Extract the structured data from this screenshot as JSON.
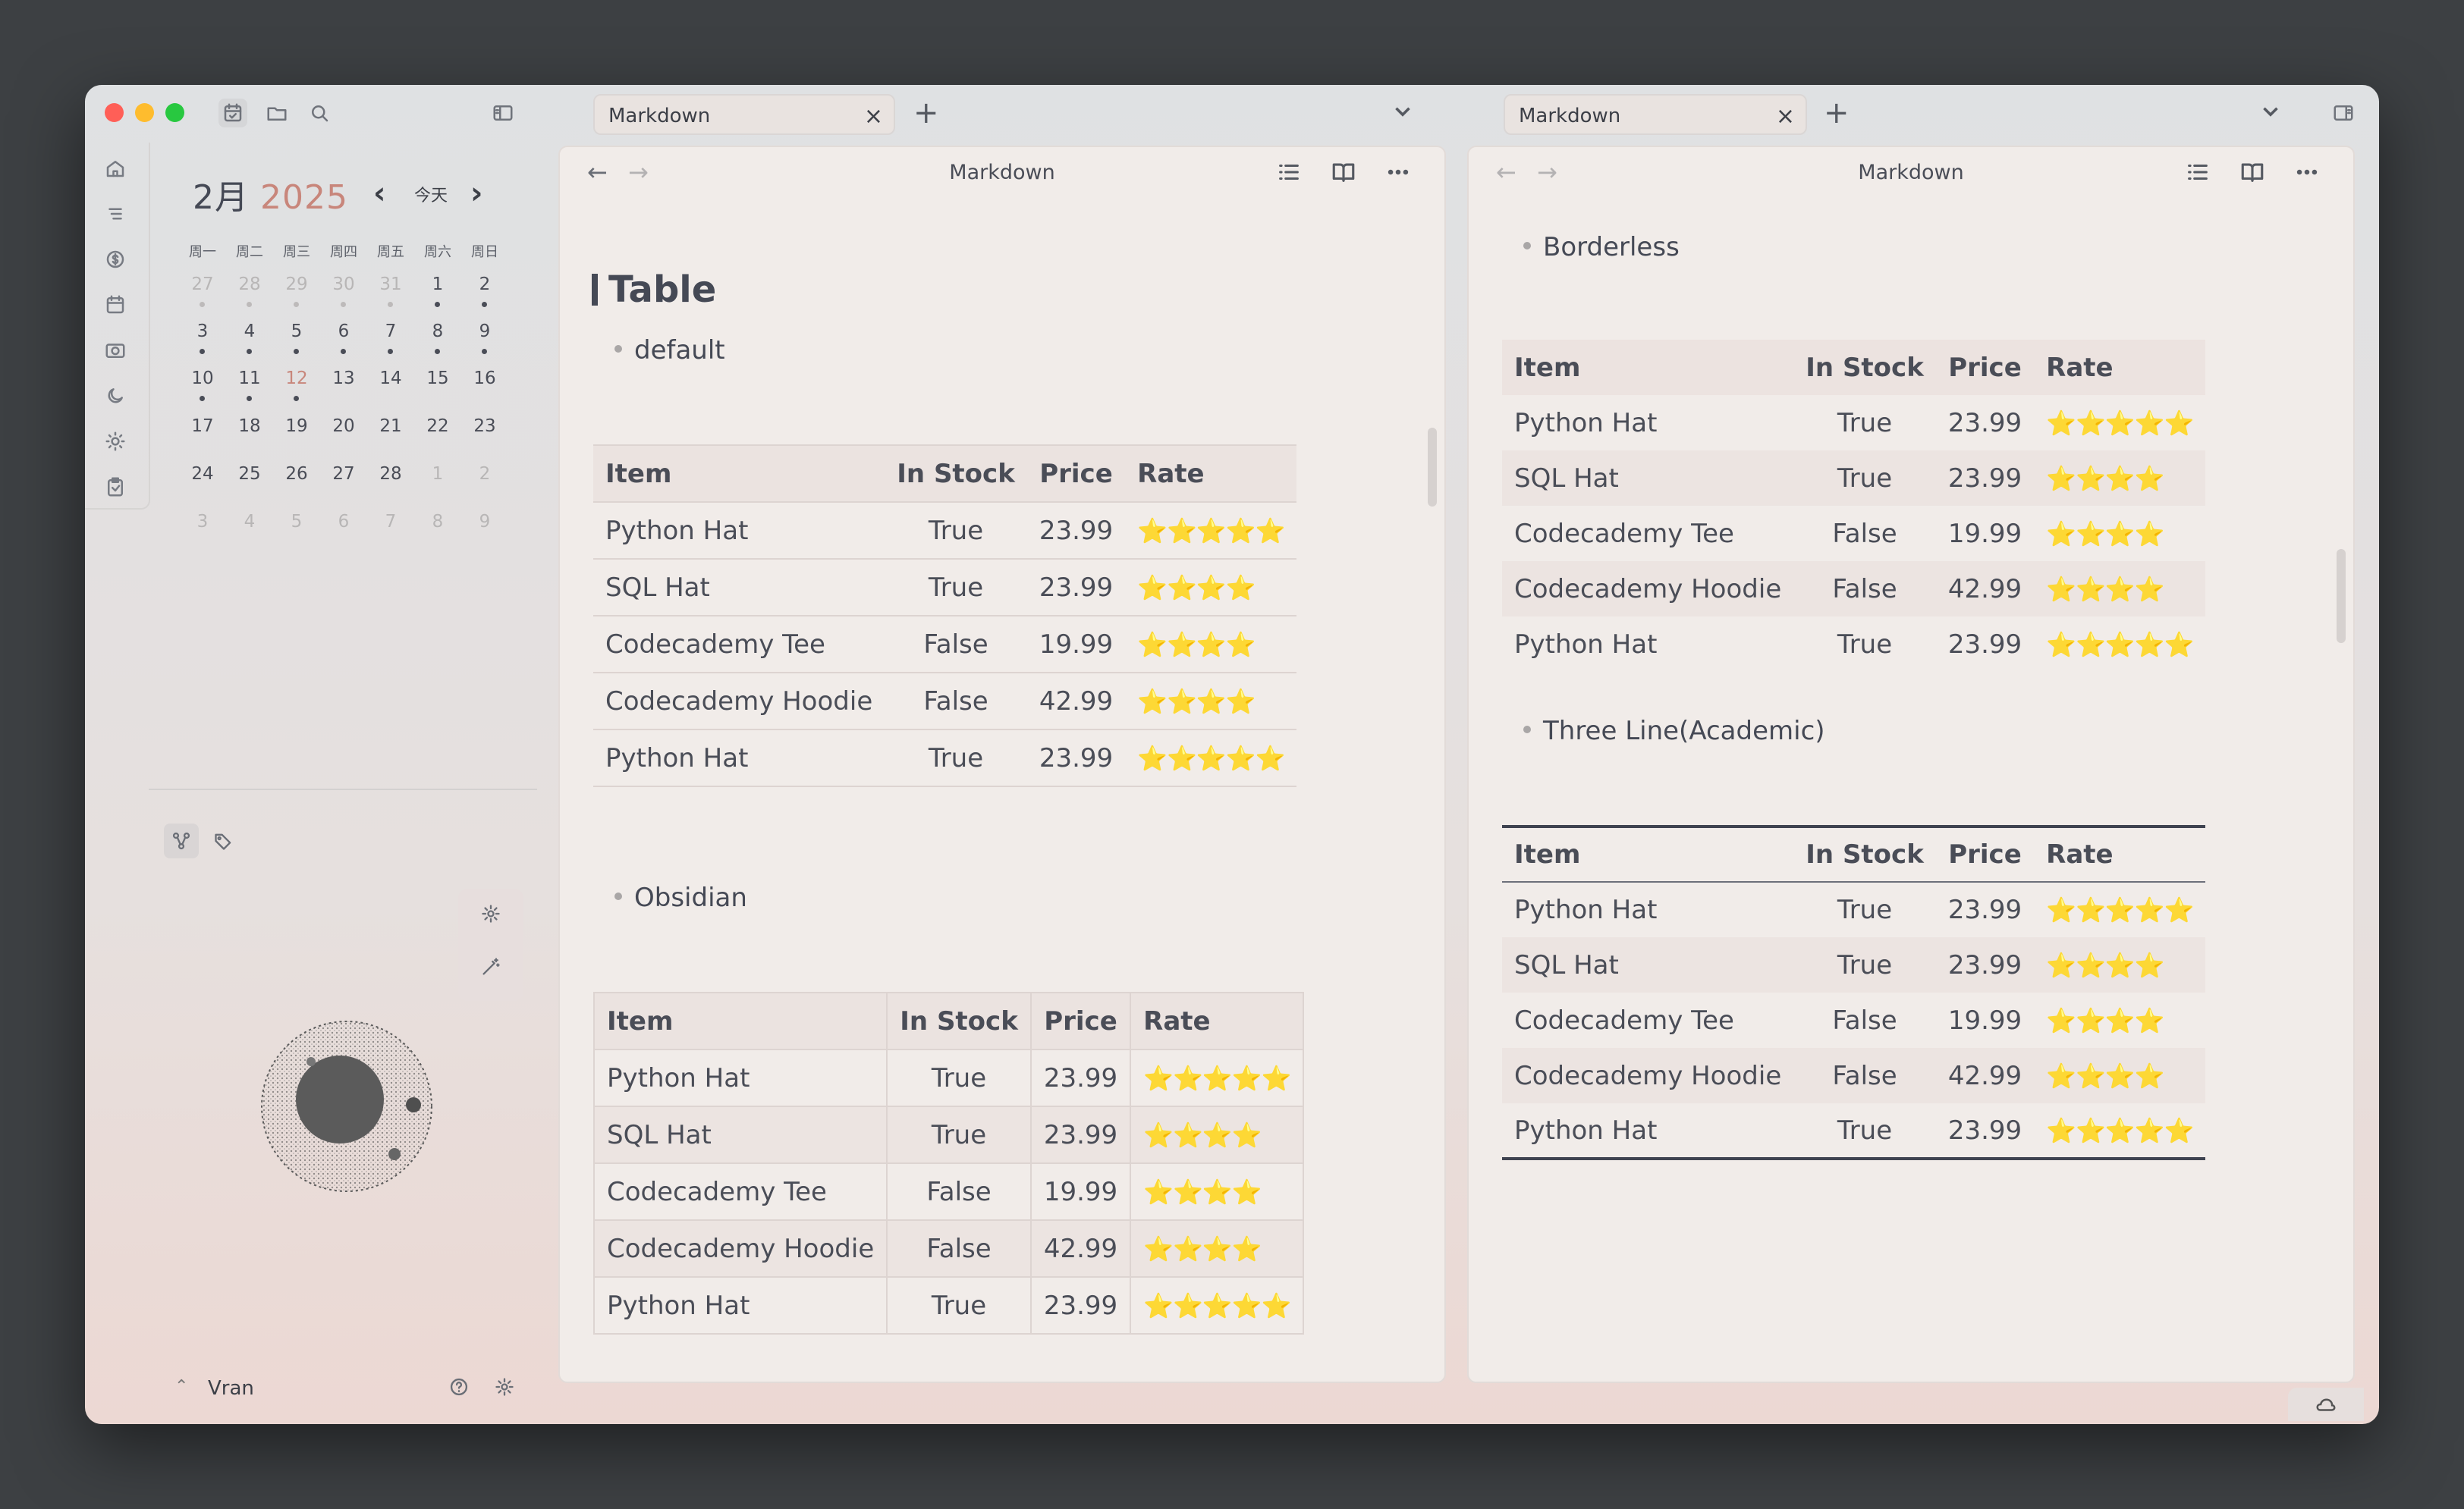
{
  "window": {
    "left_tab": {
      "label": "Markdown"
    },
    "right_tab": {
      "label": "Markdown"
    },
    "new_tab_symbol": "+",
    "close_symbol": "×"
  },
  "calendar": {
    "month": "2月",
    "year": "2025",
    "today_label": "今天",
    "weekdays": [
      "周一",
      "周二",
      "周三",
      "周四",
      "周五",
      "周六",
      "周日"
    ],
    "weeks": [
      [
        "27",
        "28",
        "29",
        "30",
        "31",
        "1",
        "2"
      ],
      [
        "3",
        "4",
        "5",
        "6",
        "7",
        "8",
        "9"
      ],
      [
        "10",
        "11",
        "12",
        "13",
        "14",
        "15",
        "16"
      ],
      [
        "17",
        "18",
        "19",
        "20",
        "21",
        "22",
        "23"
      ],
      [
        "24",
        "25",
        "26",
        "27",
        "28",
        "1",
        "2"
      ],
      [
        "3",
        "4",
        "5",
        "6",
        "7",
        "8",
        "9"
      ]
    ]
  },
  "vault": {
    "name": "Vran"
  },
  "left_pane": {
    "header_title": "Markdown",
    "heading": "Table",
    "section_default": "default",
    "section_obsidian": "Obsidian"
  },
  "right_pane": {
    "header_title": "Markdown",
    "section_borderless": "Borderless",
    "section_three_line": "Three Line(Academic)"
  },
  "table": {
    "headers": [
      "Item",
      "In Stock",
      "Price",
      "Rate"
    ],
    "rows": [
      {
        "item": "Python Hat",
        "stock": "True",
        "price": "23.99",
        "rate": "⭐⭐⭐⭐⭐"
      },
      {
        "item": "SQL Hat",
        "stock": "True",
        "price": "23.99",
        "rate": "⭐⭐⭐⭐"
      },
      {
        "item": "Codecademy Tee",
        "stock": "False",
        "price": "19.99",
        "rate": "⭐⭐⭐⭐"
      },
      {
        "item": "Codecademy Hoodie",
        "stock": "False",
        "price": "42.99",
        "rate": "⭐⭐⭐⭐"
      },
      {
        "item": "Python Hat",
        "stock": "True",
        "price": "23.99",
        "rate": "⭐⭐⭐⭐⭐"
      }
    ]
  },
  "colors": {
    "accent_year": "#c8867b",
    "star": "#f2c12e"
  }
}
